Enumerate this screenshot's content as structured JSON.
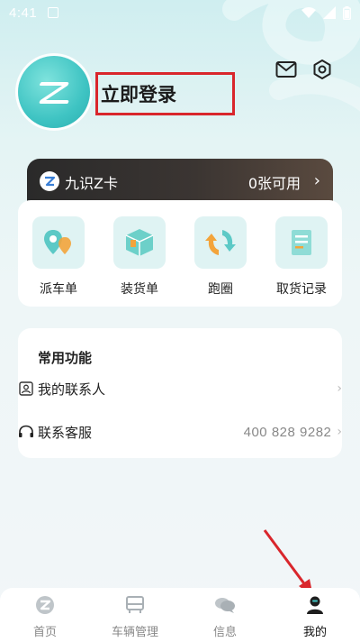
{
  "status_bar": {
    "time": "4:41"
  },
  "profile": {
    "login_label": "立即登录"
  },
  "zcard": {
    "title": "九识Z卡",
    "available": "0张可用"
  },
  "actions": [
    {
      "label": "派车单",
      "icon": "dispatch-icon"
    },
    {
      "label": "装货单",
      "icon": "box-icon"
    },
    {
      "label": "跑圈",
      "icon": "cycle-icon"
    },
    {
      "label": "取货记录",
      "icon": "record-icon"
    }
  ],
  "common": {
    "title": "常用功能",
    "contacts": {
      "label": "我的联系人"
    },
    "service": {
      "label": "联系客服",
      "phone": "400 828 9282"
    }
  },
  "tabs": [
    {
      "label": "首页",
      "icon": "home-icon"
    },
    {
      "label": "车辆管理",
      "icon": "vehicle-icon"
    },
    {
      "label": "信息",
      "icon": "message-icon"
    },
    {
      "label": "我的",
      "icon": "profile-icon"
    }
  ],
  "colors": {
    "accent": "#3fc4c3",
    "annotation": "#d9262c",
    "card_dark": "#2a2a2a"
  }
}
